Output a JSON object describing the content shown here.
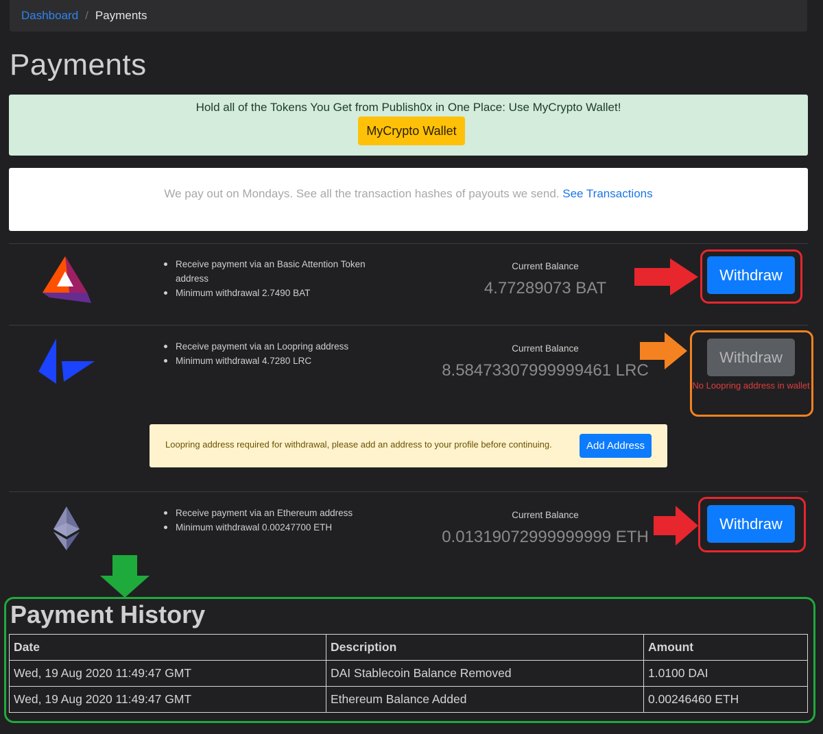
{
  "breadcrumb": {
    "link": "Dashboard",
    "separator": "/",
    "current": "Payments"
  },
  "page_title": "Payments",
  "promo": {
    "text": "Hold all of the Tokens You Get from Publish0x in One Place: Use MyCrypto Wallet!",
    "button": "MyCrypto Wallet"
  },
  "info": {
    "text": "We pay out on Mondays. See all the transaction hashes of payouts we send. ",
    "link": "See Transactions"
  },
  "tokens": [
    {
      "icon": "bat-logo-icon",
      "bullet1": "Receive payment via an Basic Attention Token address",
      "bullet2": "Minimum withdrawal 2.7490 BAT",
      "balance_label": "Current Balance",
      "balance": "4.77289073 BAT",
      "button": "Withdraw"
    },
    {
      "icon": "loopring-logo-icon",
      "bullet1": "Receive payment via an Loopring address",
      "bullet2": "Minimum withdrawal 4.7280 LRC",
      "balance_label": "Current Balance",
      "balance": "8.58473307999999461 LRC",
      "button": "Withdraw",
      "warning": "No Loopring address in wallet"
    },
    {
      "icon": "ethereum-logo-icon",
      "bullet1": "Receive payment via an Ethereum address",
      "bullet2": "Minimum withdrawal 0.00247700 ETH",
      "balance_label": "Current Balance",
      "balance": "0.01319072999999999 ETH",
      "button": "Withdraw"
    }
  ],
  "alert": {
    "text": "Loopring address required for withdrawal, please add an address to your profile before continuing.",
    "button": "Add Address"
  },
  "history": {
    "title": "Payment History",
    "columns": [
      "Date",
      "Description",
      "Amount"
    ],
    "rows": [
      [
        "Wed, 19 Aug 2020 11:49:47 GMT",
        "DAI Stablecoin Balance Removed",
        "1.0100 DAI"
      ],
      [
        "Wed, 19 Aug 2020 11:49:47 GMT",
        "Ethereum Balance Added",
        "0.00246460 ETH"
      ]
    ]
  },
  "annotation_colors": {
    "red": "#e8262d",
    "orange": "#f58220",
    "green": "#1faa3c"
  }
}
